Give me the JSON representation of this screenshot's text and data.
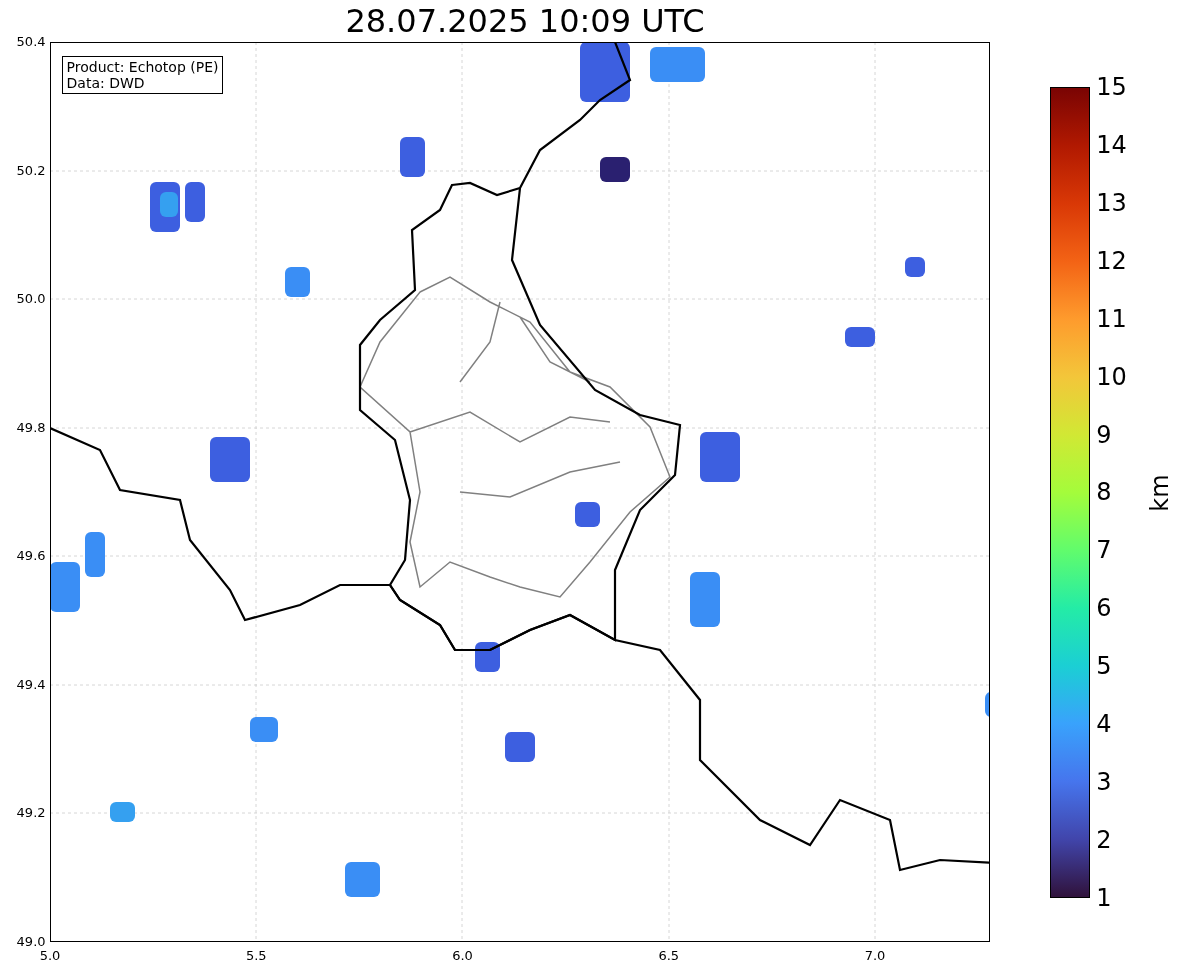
{
  "title": "28.07.2025 10:09 UTC",
  "legend": [
    "Product: Echotop (PE)",
    "Data: DWD"
  ],
  "y_ticks": [
    "50.4",
    "50.2",
    "50.0",
    "49.8",
    "49.6",
    "49.4",
    "49.2",
    "49.0"
  ],
  "x_ticks": [
    "5.0",
    "5.5",
    "6.0",
    "6.5",
    "7.0"
  ],
  "colorbar": {
    "label": "km",
    "ticks": [
      "15",
      "14",
      "13",
      "12",
      "11",
      "10",
      "9",
      "8",
      "7",
      "6",
      "5",
      "4",
      "3",
      "2",
      "1"
    ]
  }
}
